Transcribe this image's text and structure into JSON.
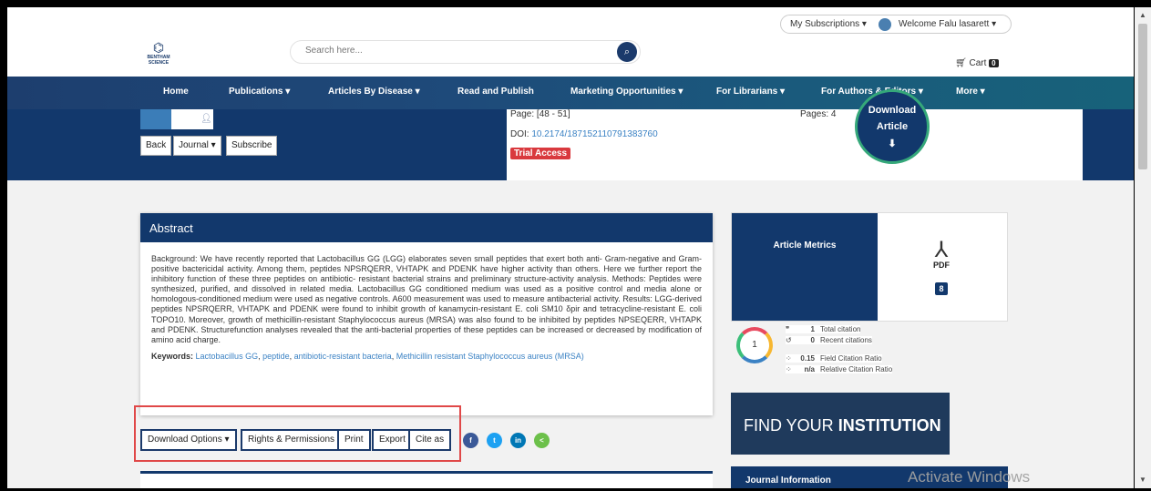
{
  "topbar": {
    "subscriptions": "My Subscriptions ▾",
    "welcome": "Welcome Falu lasarett ▾"
  },
  "header": {
    "logo_text": "BENTHAM SCIENCE",
    "search_placeholder": "Search here...",
    "cart_label": "Cart",
    "cart_count": "0"
  },
  "nav": {
    "items": [
      "Home",
      "Publications ▾",
      "Articles By Disease ▾",
      "Read and Publish",
      "Marketing Opportunities ▾",
      "For Librarians ▾",
      "For Authors & Editors ▾",
      "More ▾"
    ]
  },
  "hero": {
    "back": "Back",
    "journal": "Journal ▾",
    "subscribe": "Subscribe",
    "page": "Page: [48 - 51]",
    "doi_label": "DOI:",
    "doi": "10.2174/187152110791383760",
    "trial": "Trial Access",
    "pages": "Pages: 4",
    "download_line1": "Download",
    "download_line2": "Article"
  },
  "abstract": {
    "title": "Abstract",
    "text": "Background: We have recently reported that Lactobacillus GG (LGG) elaborates seven small peptides that exert both anti- Gram-negative and Gram-positive bactericidal activity. Among them, peptides NPSRQERR, VHTAPK and PDENK have higher activity than others. Here we further report the inhibitory function of these three peptides on antibiotic- resistant bacterial strains and preliminary structure-activity analysis. Methods: Peptides were synthesized, purified, and dissolved in related media. Lactobacillus GG conditioned medium was used as a positive control and media alone or homologous-conditioned medium were used as negative controls. A600 measurement was used to measure antibacterial activity. Results: LGG-derived peptides NPSRQERR, VHTAPK and PDENK were found to inhibit growth of kanamycin-resistant E. coli SM10 δpir and tetracycline-resistant E. coli TOPO10. Moreover, growth of methicillin-resistant Staphylococcus aureus (MRSA) was also found to be inhibited by peptides NPSEQERR, VHTAPK and PDENK. Structurefunction analyses revealed that the anti-bacterial properties of these peptides can be increased or decreased by modification of amino acid charge.",
    "keywords_label": "Keywords:",
    "keywords": [
      "Lactobacillus GG",
      "peptide",
      "antibiotic-resistant bacteria",
      "Methicillin resistant Staphylococcus aureus (MRSA)"
    ]
  },
  "actions": {
    "download_options": "Download Options ▾",
    "rights": "Rights & Permissions",
    "print": "Print",
    "export": "Export",
    "cite": "Cite as",
    "social": [
      {
        "name": "facebook",
        "glyph": "f",
        "color": "#3b5998"
      },
      {
        "name": "twitter",
        "glyph": "t",
        "color": "#1da1f2"
      },
      {
        "name": "linkedin",
        "glyph": "in",
        "color": "#0077b5"
      },
      {
        "name": "share",
        "glyph": "<",
        "color": "#6cc04a"
      }
    ]
  },
  "metrics": {
    "title": "Article Metrics",
    "pdf_label": "PDF",
    "pdf_count": "8",
    "dimensions_score": "1",
    "rows": [
      {
        "value": "1",
        "label": "Total citation"
      },
      {
        "value": "0",
        "label": "Recent citations"
      },
      {
        "value": "0.15",
        "label": "Field Citation Ratio"
      },
      {
        "value": "n/a",
        "label": "Relative Citation Ratio"
      }
    ]
  },
  "sidebar": {
    "find_prefix": "FIND YOUR ",
    "find_bold": "INSTITUTION",
    "journal_info": "Journal Information"
  },
  "overlay": {
    "watermark": "Activate Windows"
  }
}
